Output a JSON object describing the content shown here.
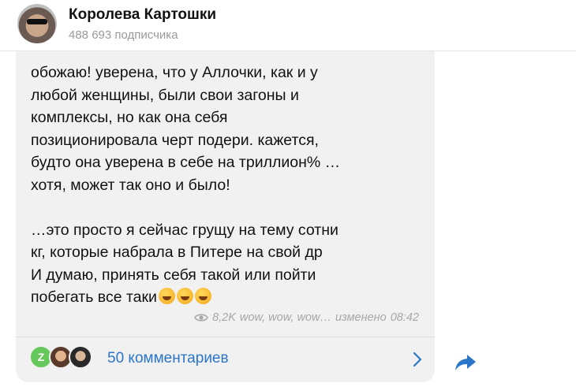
{
  "header": {
    "title": "Королева Картошки",
    "subscribers": "488 693 подписчика"
  },
  "post": {
    "text_part1": "обожаю! уверена, что у Аллочки, как и у\nлюбой женщины, были свои загоны и\nкомплексы, но как она себя\nпозиционировала черт подери. кажется,\nбудто она уверена в себе на триллион% …\nхотя, может так оно и было!\n\n…это просто я сейчас грущу на тему сотни\nкг, которые набрала в Питере на свой др\nИ думаю, принять себя такой или пойти\nпобегать все таки",
    "emojis": [
      "rolling-on-floor-laughing",
      "rolling-on-floor-laughing",
      "rolling-on-floor-laughing"
    ],
    "views": "8,2K",
    "signature": "wow, wow, wow…",
    "edited_label": "изменено",
    "time": "08:42"
  },
  "comments": {
    "label": "50 комментариев",
    "first_avatar_letter": "Z"
  },
  "colors": {
    "accent": "#2b75c9",
    "bubble": "#f1f1f1"
  },
  "icons": [
    "eye-icon",
    "chevron-right-icon",
    "share-icon"
  ]
}
